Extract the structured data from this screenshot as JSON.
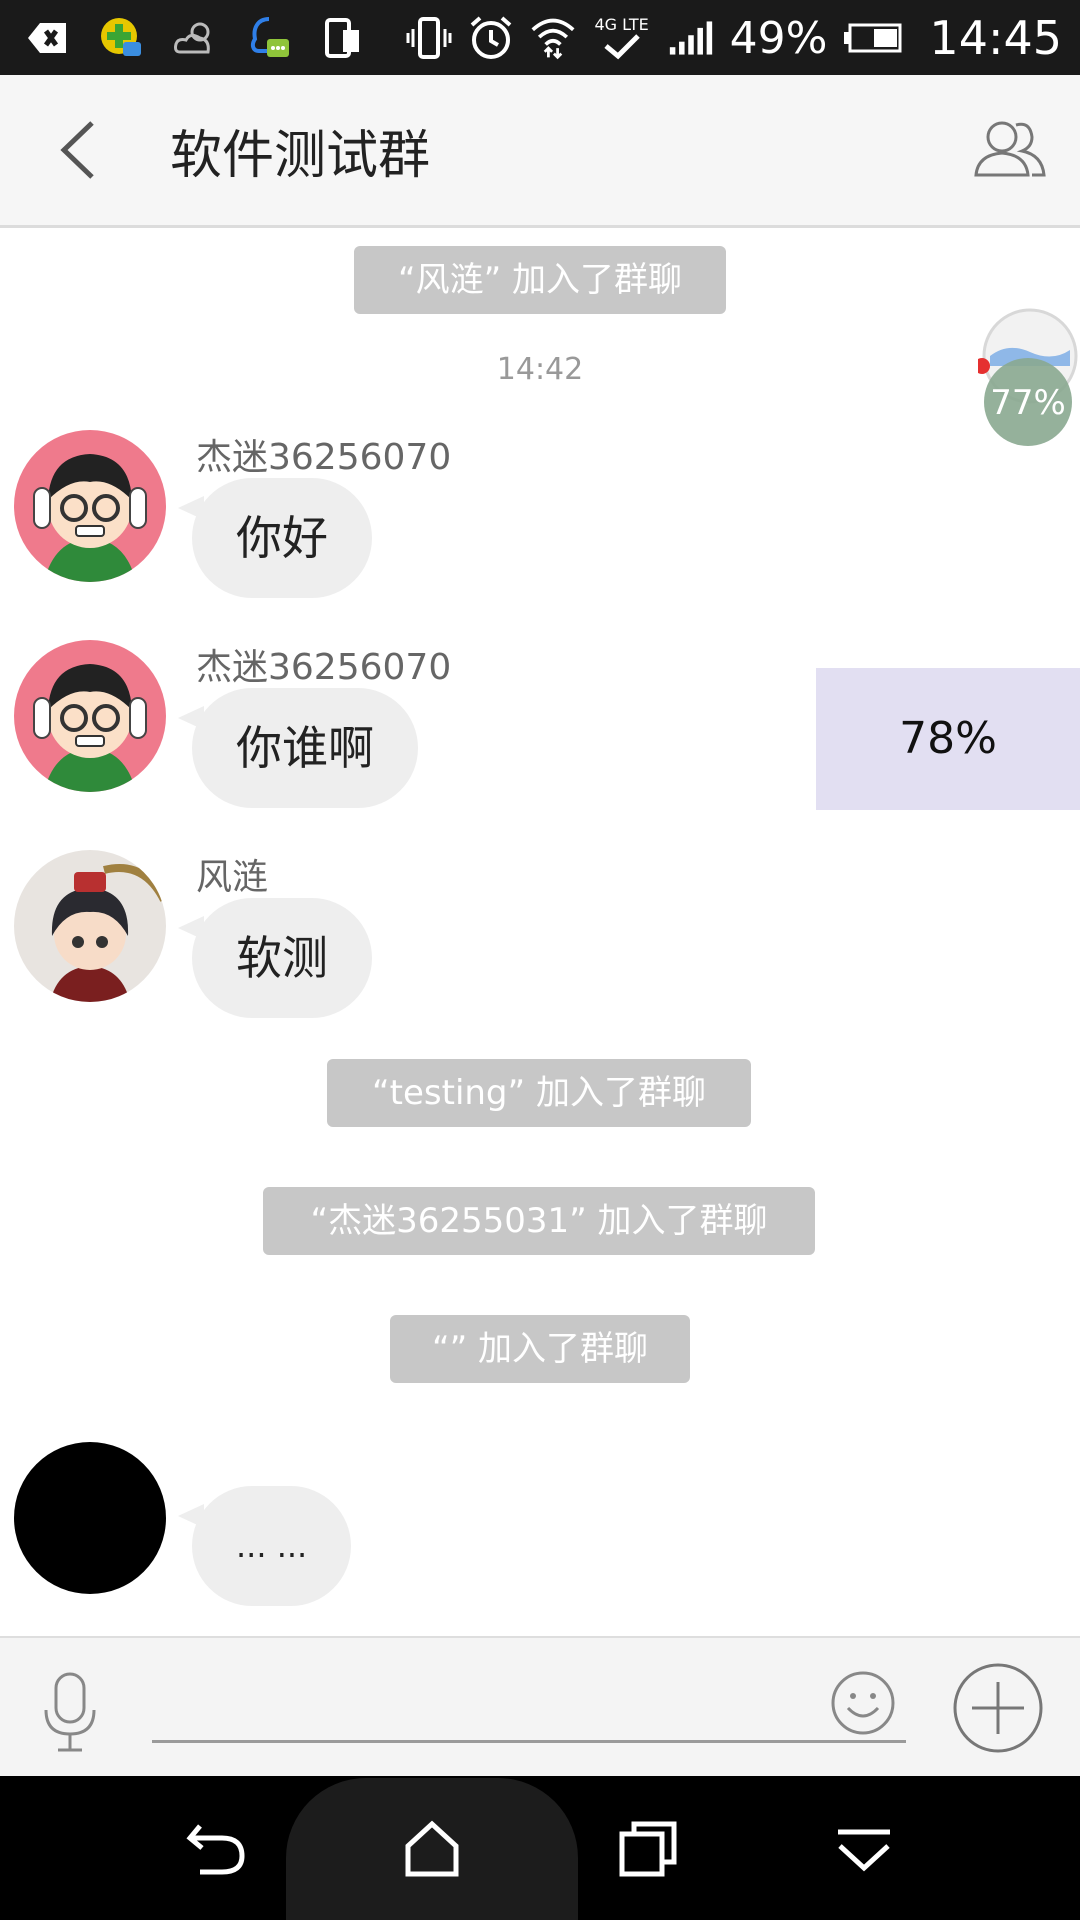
{
  "status_bar": {
    "battery": "49%",
    "time": "14:45",
    "network": "4G LTE"
  },
  "header": {
    "title": "软件测试群"
  },
  "chat": {
    "system_messages": [
      "“风涟” 加入了群聊",
      "“testing” 加入了群聊",
      "“杰迷36255031” 加入了群聊",
      "“” 加入了群聊"
    ],
    "timestamp": "14:42",
    "messages": [
      {
        "sender": "杰迷36256070",
        "text": "你好"
      },
      {
        "sender": "杰迷36256070",
        "text": "你谁啊"
      },
      {
        "sender": "风涟",
        "text": "软测"
      },
      {
        "sender": "",
        "text": "... ..."
      }
    ]
  },
  "overlay": {
    "float_ball_percent": "77%",
    "progress_panel_percent": "78%"
  },
  "input": {
    "placeholder": "",
    "value": ""
  },
  "colors": {
    "system_pill": "#c7c7c7",
    "bubble": "#eeeeee",
    "header_bg": "#f6f6f6",
    "panel_bg": "#e2dff2"
  }
}
